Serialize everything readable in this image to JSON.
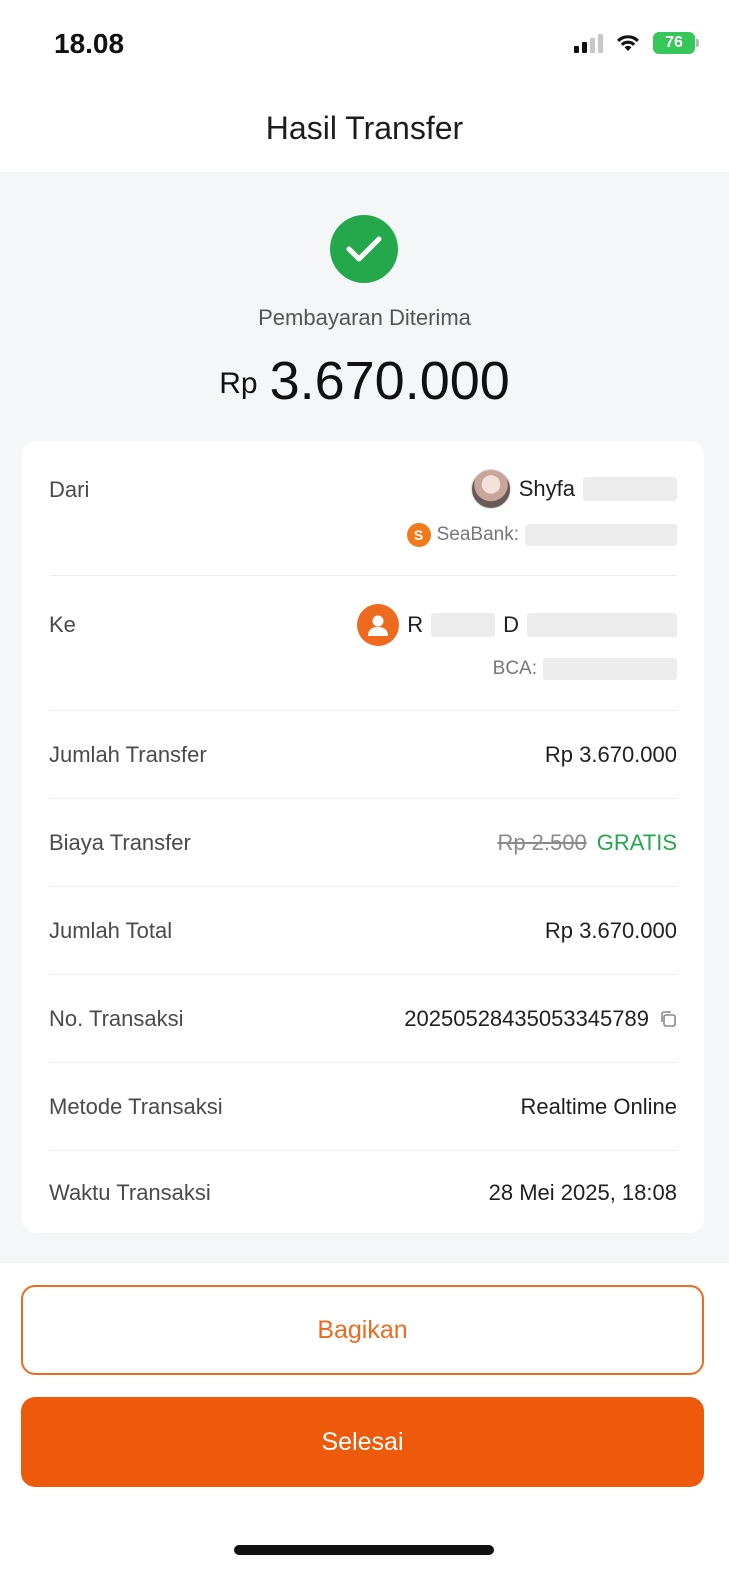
{
  "status_bar": {
    "time": "18.08",
    "battery": "76"
  },
  "header": {
    "title": "Hasil Transfer"
  },
  "result": {
    "status": "Pembayaran Diterima",
    "currency": "Rp",
    "amount": "3.670.000"
  },
  "details": {
    "from": {
      "label": "Dari",
      "name": "Shyfa",
      "bank": "SeaBank:"
    },
    "to": {
      "label": "Ke",
      "name_start": "R",
      "name_part": "D",
      "bank": "BCA:"
    },
    "transfer_amount": {
      "label": "Jumlah Transfer",
      "value": "Rp 3.670.000"
    },
    "transfer_fee": {
      "label": "Biaya Transfer",
      "original": "Rp 2.500",
      "value": "GRATIS"
    },
    "total_amount": {
      "label": "Jumlah Total",
      "value": "Rp 3.670.000"
    },
    "transaction_no": {
      "label": "No. Transaksi",
      "value": "20250528435053345789"
    },
    "method": {
      "label": "Metode Transaksi",
      "value": "Realtime Online"
    },
    "time": {
      "label": "Waktu Transaksi",
      "value": "28 Mei 2025, 18:08"
    }
  },
  "actions": {
    "share_label": "Bagikan",
    "done_label": "Selesai"
  },
  "colors": {
    "accent": "#ee5a0b",
    "success": "#25a84b"
  },
  "icons": {
    "success": "check-circle-icon",
    "copy": "copy-icon",
    "recipient_avatar": "user-icon",
    "sender_bank": "seabank-logo"
  }
}
